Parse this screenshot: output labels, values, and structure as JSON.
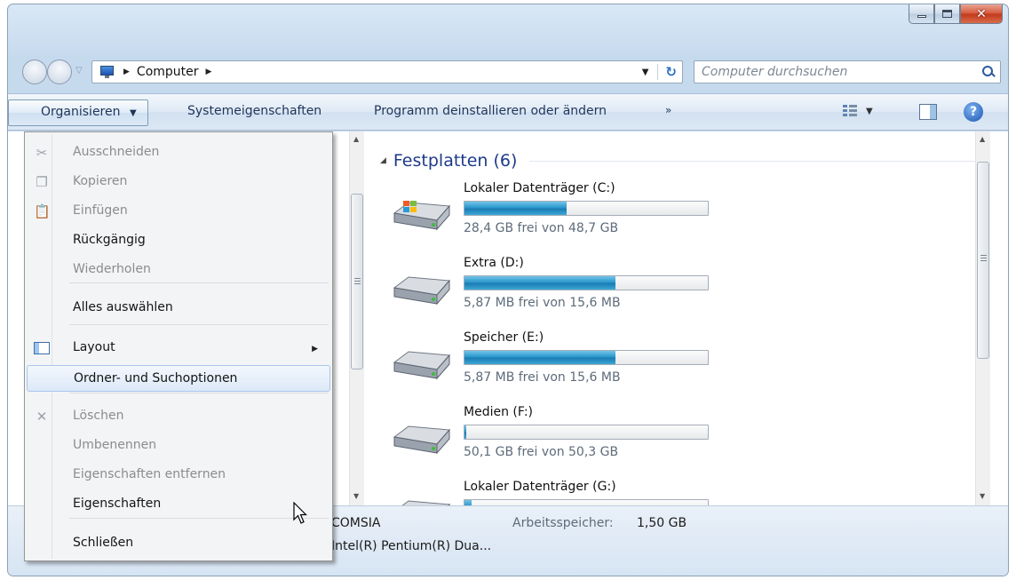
{
  "address": {
    "path_label": "Computer",
    "search_placeholder": "Computer durchsuchen"
  },
  "toolbar": {
    "organize": "Organisieren",
    "system_properties": "Systemeigenschaften",
    "uninstall": "Programm deinstallieren oder ändern",
    "more": "»"
  },
  "menu": {
    "items": [
      {
        "label": "Ausschneiden",
        "icon": "scissors-icon",
        "enabled": false
      },
      {
        "label": "Kopieren",
        "icon": "copy-icon",
        "enabled": false
      },
      {
        "label": "Einfügen",
        "icon": "paste-icon",
        "enabled": false
      },
      {
        "label": "Rückgängig",
        "enabled": true
      },
      {
        "label": "Wiederholen",
        "enabled": false
      },
      {
        "label": "Alles auswählen",
        "enabled": true
      },
      {
        "label": "Layout",
        "icon": "layout-icon",
        "enabled": true,
        "submenu": true
      },
      {
        "label": "Ordner- und Suchoptionen",
        "enabled": true,
        "highlighted": true
      },
      {
        "label": "Löschen",
        "icon": "delete-icon",
        "enabled": false
      },
      {
        "label": "Umbenennen",
        "enabled": false
      },
      {
        "label": "Eigenschaften entfernen",
        "enabled": false
      },
      {
        "label": "Eigenschaften",
        "enabled": true
      },
      {
        "label": "Schließen",
        "enabled": true
      }
    ]
  },
  "group": {
    "title": "Festplatten (6)"
  },
  "drives": [
    {
      "name": "Lokaler Datenträger (C:)",
      "free": "28,4 GB frei von 48,7 GB",
      "used_fraction": 0.42,
      "windows": true
    },
    {
      "name": "Extra (D:)",
      "free": "5,87 MB frei von 15,6 MB",
      "used_fraction": 0.62
    },
    {
      "name": "Speicher (E:)",
      "free": "5,87 MB frei von 15,6 MB",
      "used_fraction": 0.62
    },
    {
      "name": "Medien (F:)",
      "free": "50,1 GB frei von 50,3 GB",
      "used_fraction": 0.004
    },
    {
      "name": "Lokaler Datenträger (G:)",
      "free": "",
      "used_fraction": 0.03
    }
  ],
  "details": {
    "computer_name": "COMSIA",
    "ram_label": "Arbeitsspeicher:",
    "ram_value": "1,50 GB",
    "processor": "Intel(R) Pentium(R) Dua..."
  },
  "colors": {
    "accent": "#1e3a8a",
    "bar_fill": "#2a97cc",
    "close_button": "#c2381a"
  }
}
